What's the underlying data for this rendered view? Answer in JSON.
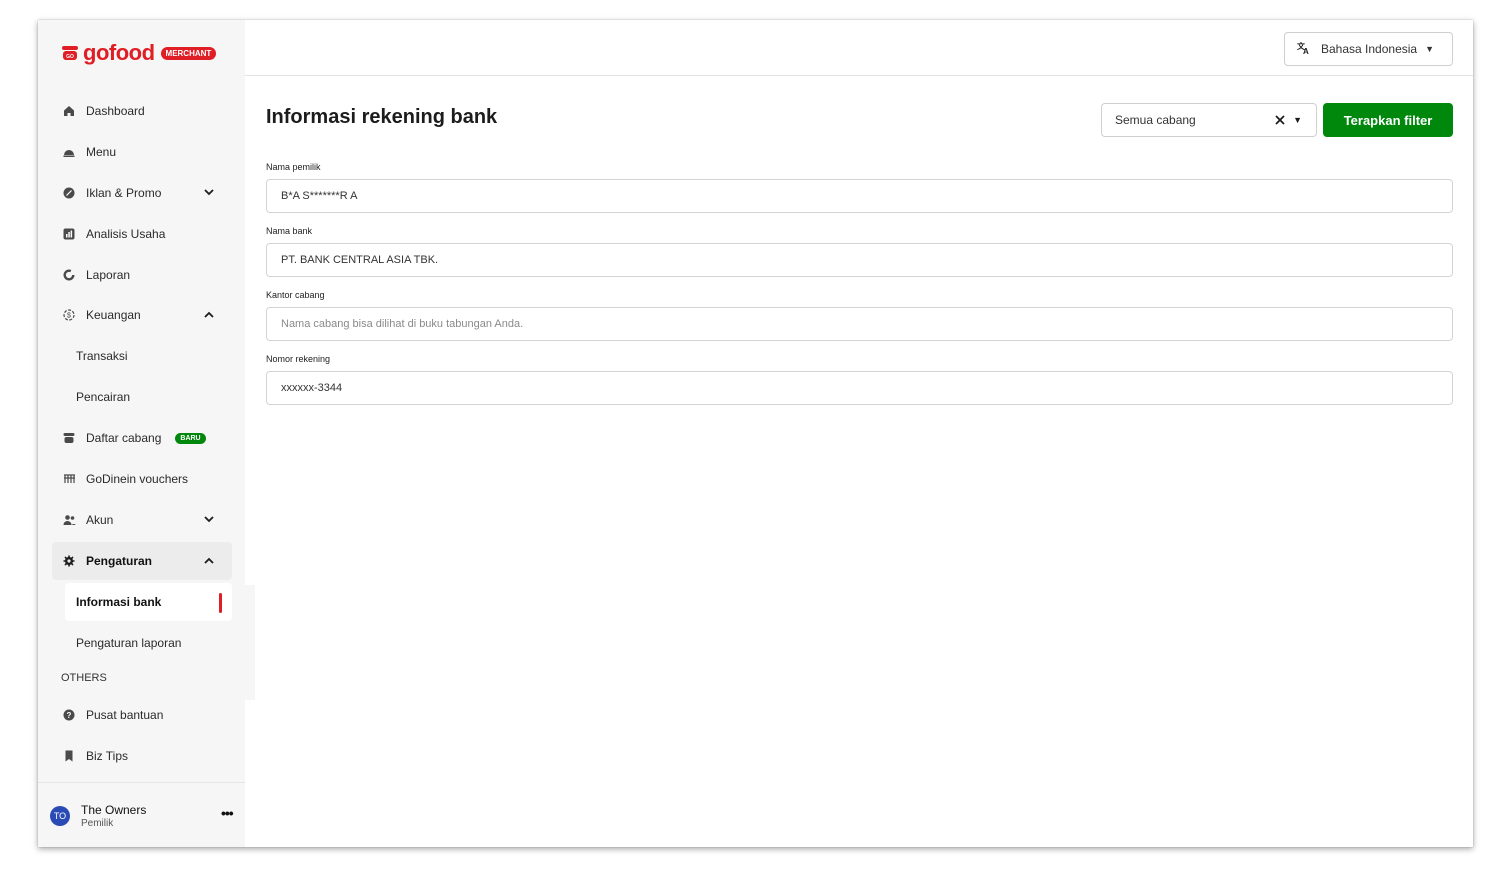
{
  "brand": {
    "name": "gofood",
    "badge": "MERCHANT",
    "color": "#e01e26"
  },
  "sidebar": {
    "items": [
      {
        "label": "Dashboard",
        "icon": "home-icon"
      },
      {
        "label": "Menu",
        "icon": "food-cover-icon"
      },
      {
        "label": "Iklan & Promo",
        "icon": "promo-icon",
        "expand": "chevron-down"
      },
      {
        "label": "Analisis Usaha",
        "icon": "analytics-icon"
      },
      {
        "label": "Laporan",
        "icon": "report-icon"
      },
      {
        "label": "Keuangan",
        "icon": "money-icon",
        "expand": "chevron-up"
      },
      {
        "label": "Transaksi"
      },
      {
        "label": "Pencairan"
      },
      {
        "label": "Daftar cabang",
        "icon": "store-icon",
        "badge": "BARU"
      },
      {
        "label": "GoDinein vouchers",
        "icon": "voucher-icon"
      },
      {
        "label": "Akun",
        "icon": "users-icon",
        "expand": "chevron-down"
      },
      {
        "label": "Pengaturan",
        "icon": "gear-icon",
        "expand": "chevron-up"
      },
      {
        "label": "Informasi bank",
        "active": true
      },
      {
        "label": "Pengaturan laporan"
      }
    ],
    "others_label": "OTHERS",
    "others": [
      {
        "label": "Pusat bantuan",
        "icon": "help-icon"
      },
      {
        "label": "Biz Tips",
        "icon": "bookmark-icon"
      }
    ],
    "user": {
      "initials": "TO",
      "name": "The Owners",
      "role": "Pemilik"
    }
  },
  "topbar": {
    "language": "Bahasa Indonesia"
  },
  "main": {
    "title": "Informasi rekening bank",
    "branch_filter": {
      "value": "Semua cabang"
    },
    "apply_label": "Terapkan filter",
    "fields": [
      {
        "label": "Nama pemilik",
        "value": "B*A S*******R A"
      },
      {
        "label": "Nama bank",
        "value": "PT. BANK CENTRAL ASIA TBK."
      },
      {
        "label": "Kantor cabang",
        "value": "",
        "placeholder": "Nama cabang bisa dilihat di buku tabungan Anda."
      },
      {
        "label": "Nomor rekening",
        "value": "xxxxxx-3344"
      }
    ]
  },
  "colors": {
    "accent_green": "#00880d",
    "accent_red": "#e01e26",
    "avatar": "#2a4ab5"
  }
}
